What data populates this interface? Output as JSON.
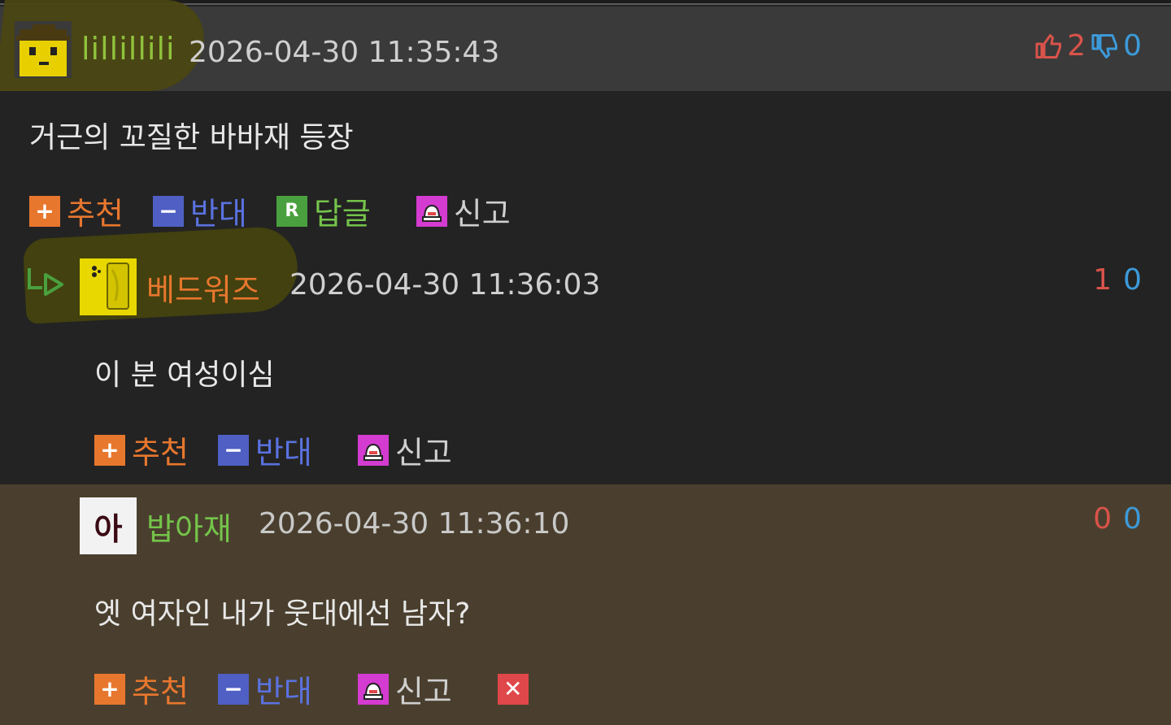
{
  "comments": [
    {
      "nickname": "lillillili",
      "date": "2026-04-30 11:35:43",
      "up": "2",
      "down": "0",
      "text": "거근의 꼬질한 바바재 등장",
      "actions": {
        "recommend": "추천",
        "oppose": "반대",
        "reply": "답글",
        "report": "신고"
      }
    },
    {
      "nickname": "베드워즈",
      "date": "2026-04-30 11:36:03",
      "up": "1",
      "down": "0",
      "text": "이 분 여성이심",
      "actions": {
        "recommend": "추천",
        "oppose": "반대",
        "report": "신고"
      }
    },
    {
      "nickname": "밥아재",
      "avatar_text": "아",
      "date": "2026-04-30 11:36:10",
      "up": "0",
      "down": "0",
      "text": "엣 여자인 내가 웃대에선 남자?",
      "actions": {
        "recommend": "추천",
        "oppose": "반대",
        "report": "신고"
      }
    }
  ],
  "icons": {
    "plus": "+",
    "minus": "−",
    "reply": "R",
    "delete": "✕"
  },
  "colors": {
    "recommend": "#e8772e",
    "oppose": "#4f5fc4",
    "reply": "#4aa03e",
    "report": "#d43bd0",
    "delete": "#e0474a",
    "vote_up": "#d9534a",
    "vote_down": "#3c9ad9"
  }
}
